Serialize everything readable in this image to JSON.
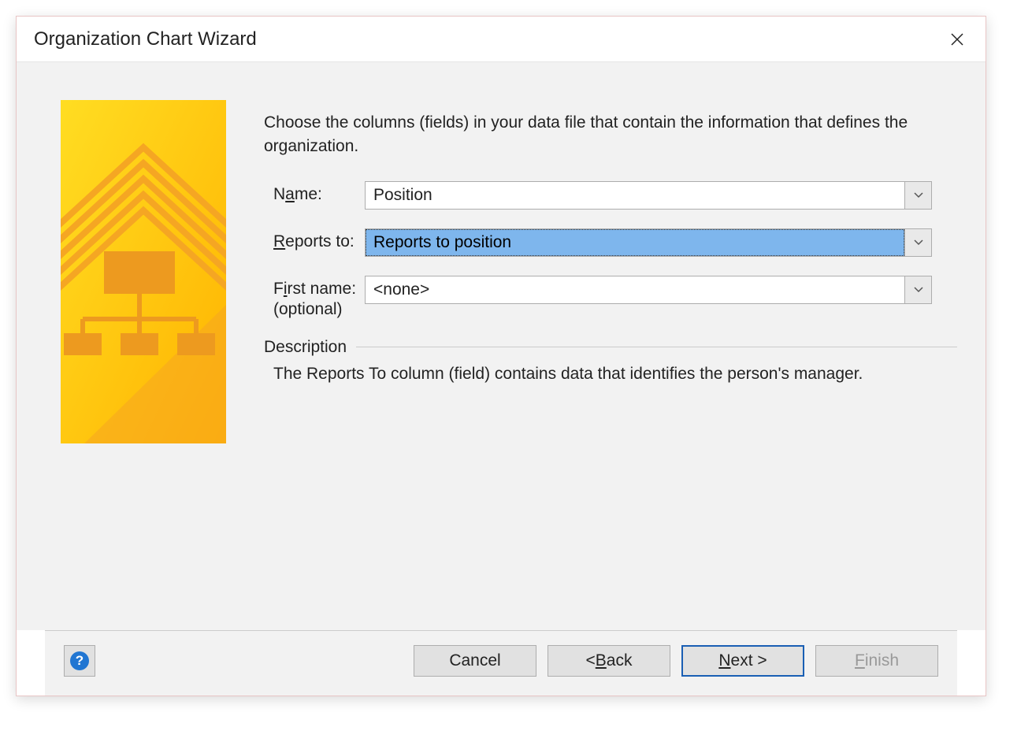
{
  "dialog": {
    "title": "Organization Chart Wizard"
  },
  "content": {
    "instruction": "Choose the columns (fields) in your data file that contain the information that defines the organization.",
    "fields": {
      "name": {
        "label_before": "N",
        "label_underline": "a",
        "label_after": "me:",
        "value": "Position"
      },
      "reports_to": {
        "label_underline": "R",
        "label_after": "eports to:",
        "value": "Reports to position"
      },
      "first_name": {
        "label_before": "F",
        "label_underline": "i",
        "label_after": "rst name:",
        "optional": "(optional)",
        "value": "<none>"
      }
    },
    "description": {
      "title": "Description",
      "text": "The Reports To column (field) contains data that identifies the person's manager."
    }
  },
  "footer": {
    "help_symbol": "?",
    "cancel": "Cancel",
    "back_prefix": "< ",
    "back_underline": "B",
    "back_after": "ack",
    "next_underline": "N",
    "next_after": "ext >",
    "finish_underline": "F",
    "finish_after": "inish"
  }
}
